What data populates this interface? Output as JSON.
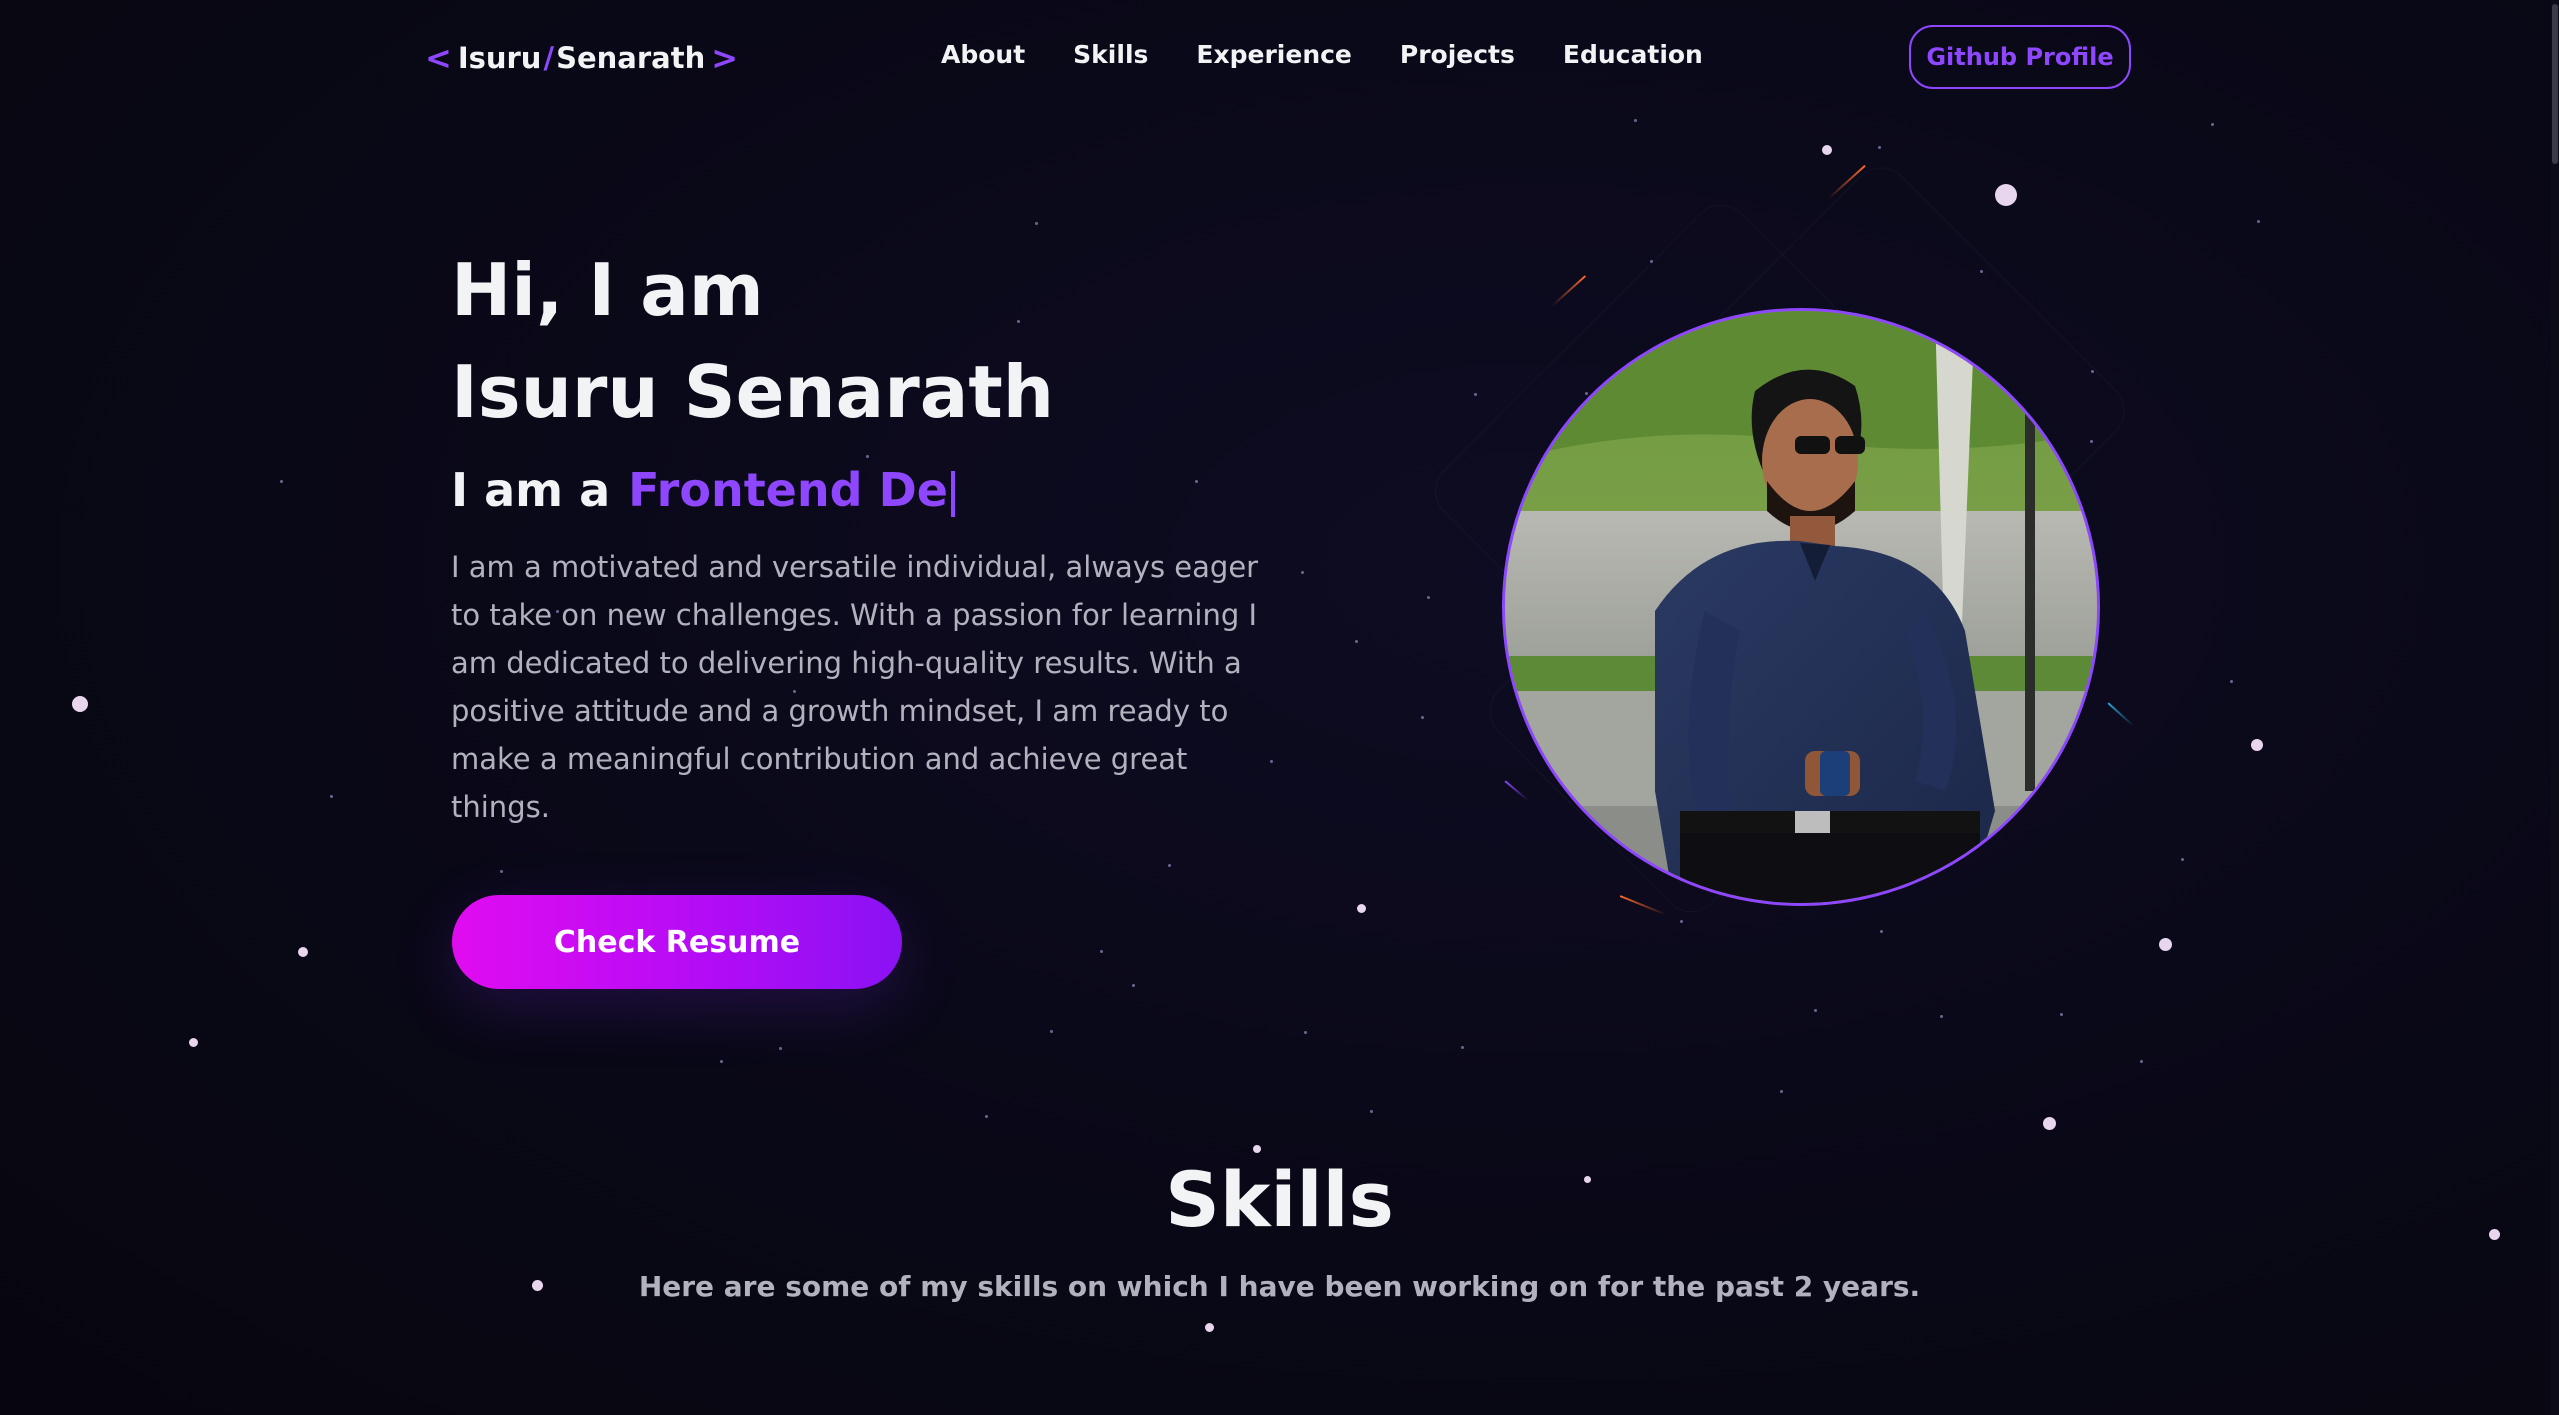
{
  "nav": {
    "logo": {
      "left_bracket": "<",
      "first": "Isuru",
      "slash": "/",
      "last": "Senarath",
      "right_bracket": ">"
    },
    "links": [
      "About",
      "Skills",
      "Experience",
      "Projects",
      "Education"
    ],
    "github_label": "Github Profile"
  },
  "hero": {
    "greeting": "Hi, I am",
    "name": "Isuru Senarath",
    "role_prefix": "I am a",
    "role_typed": "Frontend De",
    "description": "I am a motivated and versatile individual, always eager to take on new challenges. With a passion for learning I am dedicated to delivering high-quality results. With a positive attitude and a growth mindset, I am ready to make a meaningful contribution and achieve great things.",
    "resume_label": "Check Resume"
  },
  "skills": {
    "title": "Skills",
    "subtitle": "Here are some of my skills on which I have been working on for the past 2 years."
  },
  "colors": {
    "background": "#090816",
    "accent": "#8e47ff",
    "button_gradient_start": "#e10cf0",
    "button_gradient_end": "#8a12f3",
    "text_primary": "#f2f3f4",
    "text_secondary": "#b2b2bf"
  },
  "icons": {
    "profile_photo": "profile-photo"
  }
}
